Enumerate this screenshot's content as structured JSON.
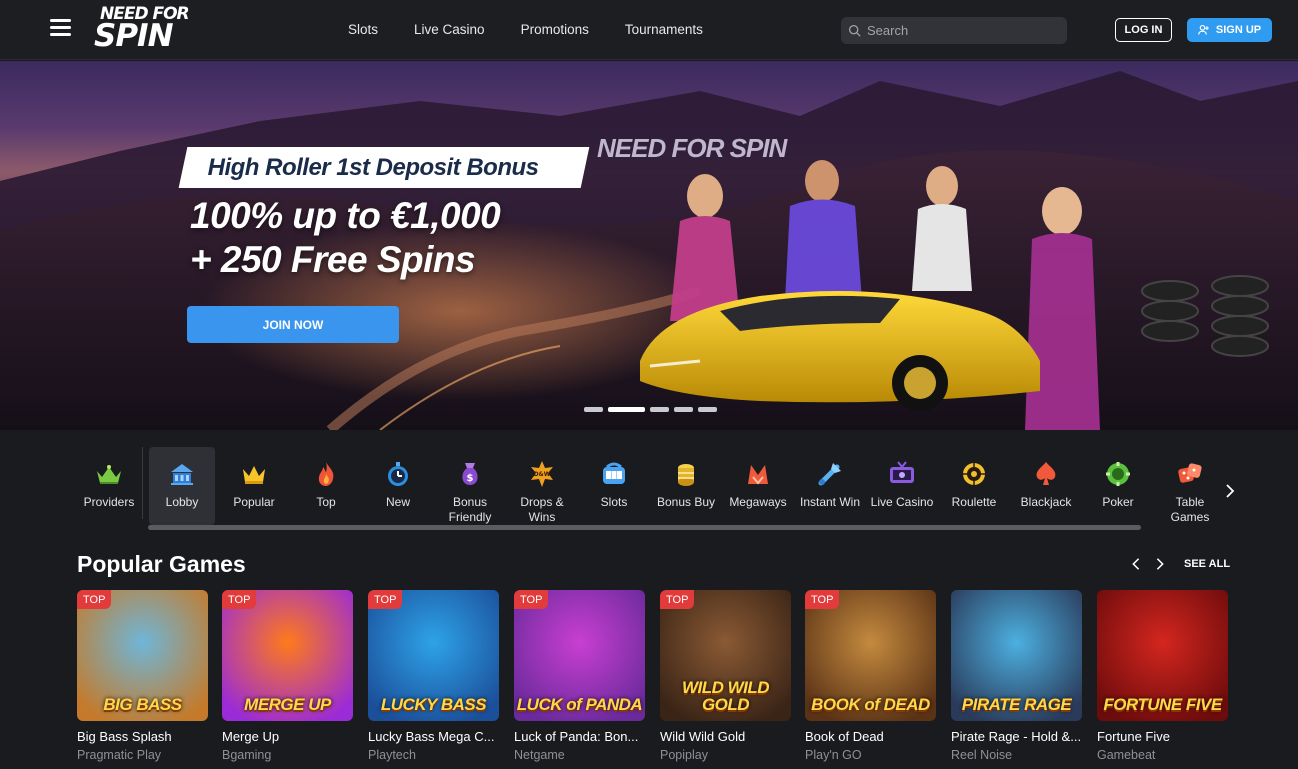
{
  "header": {
    "logo_top": "NEED FOR",
    "logo_bottom": "SPIN",
    "nav": [
      "Slots",
      "Live Casino",
      "Promotions",
      "Tournaments"
    ],
    "search_placeholder": "Search",
    "login_label": "LOG IN",
    "signup_label": "SIGN UP"
  },
  "hero": {
    "tag": "High Roller 1st Deposit Bonus",
    "line1": "100% up to €1,000",
    "line2": "+ 250 Free Spins",
    "cta": "JOIN NOW",
    "brand_sign": "NEED FOR SPIN",
    "slides": 5,
    "active_slide": 2
  },
  "categories": [
    {
      "label": "Providers",
      "icon": "crown-leaves-icon",
      "active": false
    },
    {
      "label": "Lobby",
      "icon": "lobby-icon",
      "active": true
    },
    {
      "label": "Popular",
      "icon": "crown-icon",
      "active": false
    },
    {
      "label": "Top",
      "icon": "flame-icon",
      "active": false
    },
    {
      "label": "New",
      "icon": "stopwatch-icon",
      "active": false
    },
    {
      "label": "Bonus Friendly",
      "icon": "bonus-bag-icon",
      "active": false
    },
    {
      "label": "Drops & Wins",
      "icon": "drops-wins-icon",
      "active": false
    },
    {
      "label": "Slots",
      "icon": "slot-machine-icon",
      "active": false
    },
    {
      "label": "Bonus Buy",
      "icon": "coin-stack-icon",
      "active": false
    },
    {
      "label": "Megaways",
      "icon": "megaways-icon",
      "active": false
    },
    {
      "label": "Instant Win",
      "icon": "instant-win-icon",
      "active": false
    },
    {
      "label": "Live Casino",
      "icon": "live-tv-icon",
      "active": false
    },
    {
      "label": "Roulette",
      "icon": "roulette-icon",
      "active": false
    },
    {
      "label": "Blackjack",
      "icon": "spade-icon",
      "active": false
    },
    {
      "label": "Poker",
      "icon": "poker-chip-icon",
      "active": false
    },
    {
      "label": "Table Games",
      "icon": "dice-icon",
      "active": false
    }
  ],
  "popular": {
    "title": "Popular Games",
    "see_all": "SEE ALL",
    "games": [
      {
        "name": "Big Bass Splash",
        "provider": "Pragmatic Play",
        "badge": "TOP",
        "art_title": "BIG BASS",
        "c1": "#6fb6d8",
        "c2": "#c47a2a"
      },
      {
        "name": "Merge Up",
        "provider": "Bgaming",
        "badge": "TOP",
        "art_title": "MERGE UP",
        "c1": "#ff7a1a",
        "c2": "#9b2bd6"
      },
      {
        "name": "Lucky Bass Mega C...",
        "provider": "Playtech",
        "badge": "TOP",
        "art_title": "LUCKY BASS",
        "c1": "#2ea3e8",
        "c2": "#1b4f9a"
      },
      {
        "name": "Luck of Panda: Bon...",
        "provider": "Netgame",
        "badge": "TOP",
        "art_title": "LUCK of PANDA",
        "c1": "#c83fd1",
        "c2": "#6a2a9c"
      },
      {
        "name": "Wild Wild Gold",
        "provider": "Popiplay",
        "badge": "TOP",
        "art_title": "WILD WILD GOLD",
        "c1": "#8a5a34",
        "c2": "#3a2416"
      },
      {
        "name": "Book of Dead",
        "provider": "Play'n GO",
        "badge": "TOP",
        "art_title": "BOOK of DEAD",
        "c1": "#c48a3e",
        "c2": "#5a3216"
      },
      {
        "name": "Pirate Rage - Hold &...",
        "provider": "Reel Noise",
        "badge": "",
        "art_title": "PIRATE RAGE",
        "c1": "#4cb0e0",
        "c2": "#2a3a5a"
      },
      {
        "name": "Fortune Five",
        "provider": "Gamebeat",
        "badge": "",
        "art_title": "FORTUNE FIVE",
        "c1": "#d4261f",
        "c2": "#6d0c0c"
      }
    ]
  }
}
